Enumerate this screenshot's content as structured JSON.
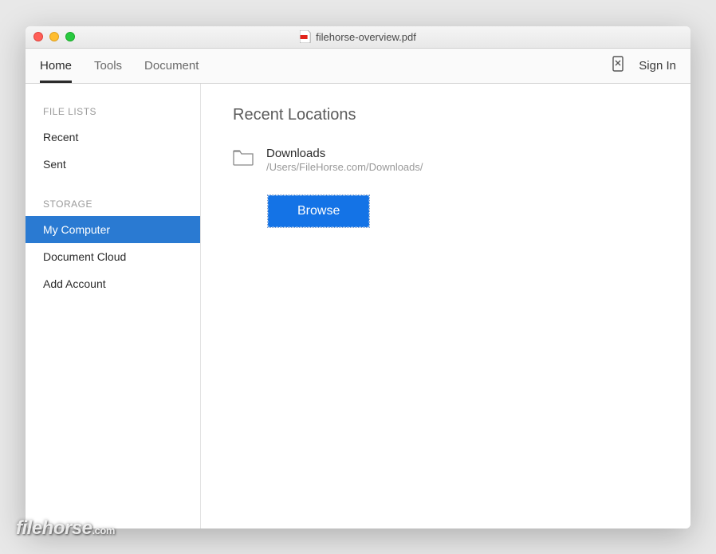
{
  "titlebar": {
    "filename": "filehorse-overview.pdf"
  },
  "toolbar": {
    "tabs": [
      {
        "label": "Home",
        "active": true
      },
      {
        "label": "Tools",
        "active": false
      },
      {
        "label": "Document",
        "active": false
      }
    ],
    "signin": "Sign In"
  },
  "sidebar": {
    "sections": [
      {
        "header": "FILE LISTS",
        "items": [
          {
            "label": "Recent",
            "selected": false
          },
          {
            "label": "Sent",
            "selected": false
          }
        ]
      },
      {
        "header": "STORAGE",
        "items": [
          {
            "label": "My Computer",
            "selected": true
          },
          {
            "label": "Document Cloud",
            "selected": false
          },
          {
            "label": "Add Account",
            "selected": false
          }
        ]
      }
    ]
  },
  "main": {
    "heading": "Recent Locations",
    "location": {
      "name": "Downloads",
      "path": "/Users/FileHorse.com/Downloads/"
    },
    "browse_label": "Browse"
  },
  "watermark": {
    "name": "filehorse",
    "suffix": ".com"
  }
}
